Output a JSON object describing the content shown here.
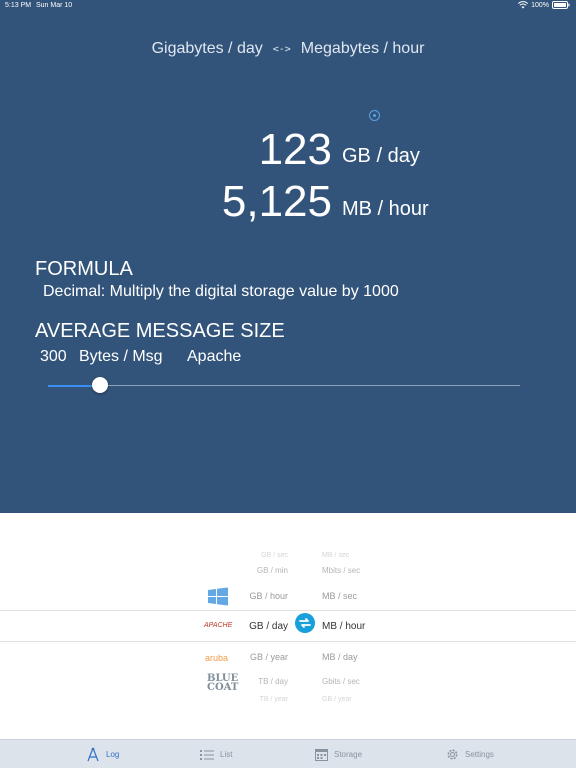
{
  "status_bar": {
    "time": "5:13 PM",
    "date": "Sun Mar 10",
    "battery": "100%"
  },
  "header": {
    "from_unit": "Gigabytes / day",
    "arrow": "<->",
    "to_unit": "Megabytes / hour"
  },
  "result": {
    "input_value": "123",
    "input_unit": "GB / day",
    "output_value": "5,125",
    "output_unit": "MB / hour"
  },
  "formula": {
    "title": "FORMULA",
    "text": "Decimal: Multiply the digital storage value by 1000"
  },
  "avg_message": {
    "title": "AVERAGE MESSAGE SIZE",
    "value": "300",
    "unit": "Bytes / Msg",
    "source": "Apache",
    "slider_fraction": 0.11
  },
  "picker": {
    "rows": [
      {
        "left": "GB / sec",
        "right": "MB / sec"
      },
      {
        "left": "GB / min",
        "right": "Mbits / sec"
      },
      {
        "left": "GB / hour",
        "right": "MB / sec"
      },
      {
        "left": "GB / day",
        "right": "MB / hour"
      },
      {
        "left": "GB / year",
        "right": "MB / day"
      },
      {
        "left": "TB / day",
        "right": "Gbits / sec"
      },
      {
        "left": "TB / year",
        "right": "GB / year"
      }
    ],
    "logos": {
      "apache": "APACHE",
      "aruba": "aruba",
      "bluecoat": "BLUE COAT"
    }
  },
  "tabs": [
    {
      "label": "Log",
      "icon": "compass-icon",
      "active": true
    },
    {
      "label": "List",
      "icon": "list-icon",
      "active": false
    },
    {
      "label": "Storage",
      "icon": "calendar-icon",
      "active": false
    },
    {
      "label": "Settings",
      "icon": "gear-icon",
      "active": false
    }
  ],
  "colors": {
    "background": "#33547a",
    "accent": "#3b8ff0",
    "swap": "#17a0dc",
    "tabbar": "#dde3ea"
  }
}
